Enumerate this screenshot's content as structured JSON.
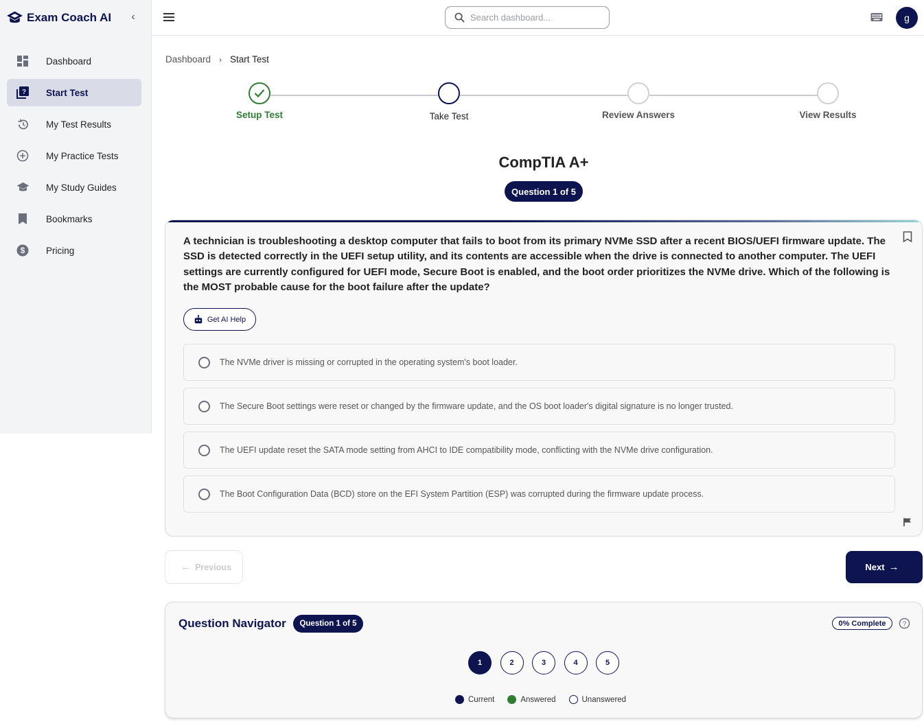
{
  "app": {
    "name": "Exam Coach AI"
  },
  "sidebar": {
    "items": [
      {
        "label": "Dashboard",
        "icon": "dashboard-icon"
      },
      {
        "label": "Start Test",
        "icon": "quiz-icon",
        "active": true
      },
      {
        "label": "My Test Results",
        "icon": "history-icon"
      },
      {
        "label": "My Practice Tests",
        "icon": "add-circle-icon"
      },
      {
        "label": "My Study Guides",
        "icon": "school-icon"
      },
      {
        "label": "Bookmarks",
        "icon": "bookmark-icon"
      },
      {
        "label": "Pricing",
        "icon": "dollar-icon"
      }
    ]
  },
  "topbar": {
    "search_placeholder": "Search dashboard...",
    "avatar_initial": "g"
  },
  "breadcrumb": {
    "parent": "Dashboard",
    "current": "Start Test"
  },
  "stepper": {
    "steps": [
      {
        "label": "Setup Test",
        "state": "done"
      },
      {
        "label": "Take Test",
        "state": "current"
      },
      {
        "label": "Review Answers",
        "state": "pending"
      },
      {
        "label": "View Results",
        "state": "pending"
      }
    ]
  },
  "test": {
    "title": "CompTIA A+",
    "progress_badge": "Question 1 of 5",
    "question": "A technician is troubleshooting a desktop computer that fails to boot from its primary NVMe SSD after a recent BIOS/UEFI firmware update. The SSD is detected correctly in the UEFI setup utility, and its contents are accessible when the drive is connected to another computer. The UEFI settings are currently configured for UEFI mode, Secure Boot is enabled, and the boot order prioritizes the NVMe drive. Which of the following is the MOST probable cause for the boot failure after the update?",
    "ai_help_label": "Get AI Help",
    "options": [
      "The NVMe driver is missing or corrupted in the operating system's boot loader.",
      "The Secure Boot settings were reset or changed by the firmware update, and the OS boot loader's digital signature is no longer trusted.",
      "The UEFI update reset the SATA mode setting from AHCI to IDE compatibility mode, conflicting with the NVMe drive configuration.",
      "The Boot Configuration Data (BCD) store on the EFI System Partition (ESP) was corrupted during the firmware update process."
    ]
  },
  "controls": {
    "previous_label": "Previous",
    "next_label": "Next"
  },
  "navigator": {
    "title": "Question Navigator",
    "badge": "Question 1 of 5",
    "complete": "0% Complete",
    "numbers": [
      "1",
      "2",
      "3",
      "4",
      "5"
    ],
    "current": 1,
    "legend": {
      "current": "Current",
      "answered": "Answered",
      "unanswered": "Unanswered"
    }
  },
  "colors": {
    "primary": "#0d1450",
    "success": "#2e7d32",
    "answered_dot": "#2e7d32"
  }
}
